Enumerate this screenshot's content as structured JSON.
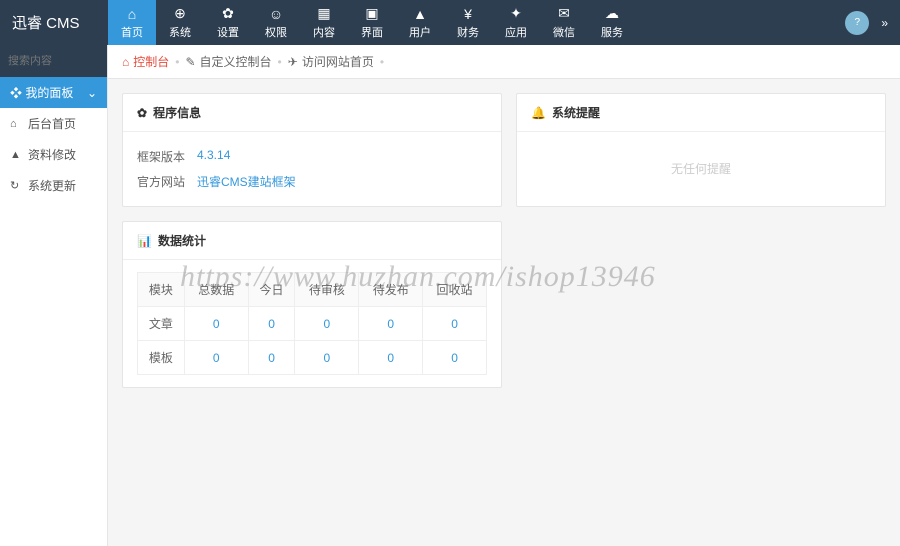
{
  "brand": "迅睿 CMS",
  "nav": [
    {
      "label": "首页",
      "icon": "⌂"
    },
    {
      "label": "系统",
      "icon": "⊕"
    },
    {
      "label": "设置",
      "icon": "✿"
    },
    {
      "label": "权限",
      "icon": "☺"
    },
    {
      "label": "内容",
      "icon": "▦"
    },
    {
      "label": "界面",
      "icon": "▣"
    },
    {
      "label": "用户",
      "icon": "▲"
    },
    {
      "label": "财务",
      "icon": "¥"
    },
    {
      "label": "应用",
      "icon": "✦"
    },
    {
      "label": "微信",
      "icon": "✉"
    },
    {
      "label": "服务",
      "icon": "☁"
    }
  ],
  "search": {
    "placeholder": "搜索内容"
  },
  "sidebar": {
    "section": "我的面板",
    "items": [
      {
        "icon": "⌂",
        "label": "后台首页"
      },
      {
        "icon": "▲",
        "label": "资料修改"
      },
      {
        "icon": "↻",
        "label": "系统更新"
      }
    ]
  },
  "breadcrumb": {
    "home": "控制台",
    "custom": "自定义控制台",
    "visit": "访问网站首页"
  },
  "info": {
    "title": "程序信息",
    "rows": [
      {
        "label": "框架版本",
        "value": "4.3.14"
      },
      {
        "label": "官方网站",
        "value": "迅睿CMS建站框架"
      }
    ]
  },
  "alert": {
    "title": "系统提醒",
    "empty": "无任何提醒"
  },
  "stats": {
    "title": "数据统计",
    "headers": [
      "模块",
      "总数据",
      "今日",
      "待审核",
      "待发布",
      "回收站"
    ],
    "rows": [
      {
        "name": "文章",
        "values": [
          "0",
          "0",
          "0",
          "0",
          "0"
        ]
      },
      {
        "name": "模板",
        "values": [
          "0",
          "0",
          "0",
          "0",
          "0"
        ]
      }
    ]
  },
  "watermark": "https://www.huzhan.com/ishop13946"
}
